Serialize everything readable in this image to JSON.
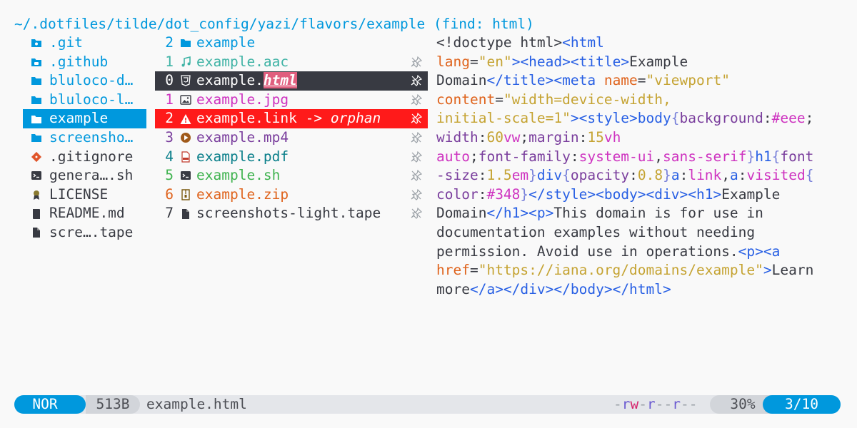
{
  "header": {
    "path": "~/.dotfiles/tilde/dot_config/yazi/flavors/example (find: html)"
  },
  "colors": {
    "accent": "#0098dd",
    "warning": "#ff1a1a",
    "selected": "#383a42",
    "highlight": "#e05e7e"
  },
  "parent": {
    "items": [
      {
        "name": ".git",
        "icon": "git-folder-icon",
        "color": "#0098dd"
      },
      {
        "name": ".github",
        "icon": "github-folder-icon",
        "color": "#0098dd"
      },
      {
        "name": "bluloco-d…",
        "icon": "folder-icon",
        "color": "#0098dd"
      },
      {
        "name": "bluloco-l…",
        "icon": "folder-icon",
        "color": "#0098dd"
      },
      {
        "name": "example",
        "icon": "folder-icon",
        "color": "#ffffff",
        "selected": true
      },
      {
        "name": "screensho…",
        "icon": "folder-icon",
        "color": "#0098dd"
      },
      {
        "name": ".gitignore",
        "icon": "git-icon",
        "color": "#383a42"
      },
      {
        "name": "genera….sh",
        "icon": "terminal-icon",
        "color": "#383a42"
      },
      {
        "name": "LICENSE",
        "icon": "license-icon",
        "color": "#383a42"
      },
      {
        "name": "README.md",
        "icon": "book-icon",
        "color": "#383a42"
      },
      {
        "name": "scre….tape",
        "icon": "file-icon",
        "color": "#383a42"
      }
    ]
  },
  "current": {
    "items": [
      {
        "num": "2",
        "name": "example",
        "icon": "folder-icon",
        "color": "#0098dd",
        "numcolor": "#0098dd"
      },
      {
        "num": "1",
        "name": "example.aac",
        "icon": "music-icon",
        "color": "#3fb3a5",
        "numcolor": "#3fb3a5",
        "pinned": true
      },
      {
        "num": "0",
        "name": "example.",
        "match": "html",
        "icon": "html5-icon",
        "color": "#ffffff",
        "numcolor": "#ffffff",
        "pinned": true,
        "selected": true
      },
      {
        "num": "1",
        "name": "example.jpg",
        "icon": "image-icon",
        "color": "#ce33c0",
        "numcolor": "#ce33c0",
        "pinned": true
      },
      {
        "num": "2",
        "name": "example.link -> ",
        "suffix": "orphan",
        "icon": "warning-icon",
        "color": "#ffffff",
        "numcolor": "#ffffff",
        "pinned": true,
        "warn": true
      },
      {
        "num": "3",
        "name": "example.mp4",
        "icon": "play-icon",
        "color": "#7a3e9d",
        "numcolor": "#7a3e9d",
        "pinned": true
      },
      {
        "num": "4",
        "name": "example.pdf",
        "icon": "pdf-icon",
        "color": "#0a7f8a",
        "numcolor": "#0a7f8a",
        "pinned": true
      },
      {
        "num": "5",
        "name": "example.sh",
        "icon": "terminal-icon",
        "color": "#3fb34f",
        "numcolor": "#3fb34f",
        "pinned": true
      },
      {
        "num": "6",
        "name": "example.zip",
        "icon": "zip-icon",
        "color": "#df631c",
        "numcolor": "#df631c",
        "pinned": true
      },
      {
        "num": "7",
        "name": "screenshots-light.tape",
        "icon": "file-icon",
        "color": "#383a42",
        "numcolor": "#383a42",
        "pinned": true
      }
    ]
  },
  "preview": {
    "lines": [
      [
        [
          "t-text",
          "<!doctype html>"
        ],
        [
          "t-tag",
          "<html"
        ]
      ],
      [
        [
          "t-attr",
          "lang"
        ],
        [
          "t-text",
          "="
        ],
        [
          "t-str",
          "\"en\""
        ],
        [
          "t-tag",
          ">"
        ],
        [
          "t-tag",
          "<head>"
        ],
        [
          "t-tag",
          "<title>"
        ],
        [
          "t-text",
          "Example"
        ]
      ],
      [
        [
          "t-text",
          "Domain"
        ],
        [
          "t-tag",
          "</title>"
        ],
        [
          "t-tag",
          "<meta "
        ],
        [
          "t-attr",
          "name"
        ],
        [
          "t-text",
          "="
        ],
        [
          "t-str",
          "\"viewport\""
        ]
      ],
      [
        [
          "t-attr",
          "content"
        ],
        [
          "t-text",
          "="
        ],
        [
          "t-str",
          "\"width=device-width,"
        ]
      ],
      [
        [
          "t-str",
          "initial-scale=1\""
        ],
        [
          "t-tag",
          ">"
        ],
        [
          "t-tag",
          "<style>"
        ],
        [
          "t-tag",
          "body"
        ],
        [
          "t-punct",
          "{"
        ],
        [
          "t-prop",
          "background"
        ],
        [
          "t-text",
          ":"
        ],
        [
          "t-val",
          "#eee"
        ],
        [
          "t-text",
          ";"
        ]
      ],
      [
        [
          "t-prop",
          "width"
        ],
        [
          "t-text",
          ":"
        ],
        [
          "t-num",
          "60"
        ],
        [
          "t-val",
          "vw"
        ],
        [
          "t-text",
          ";"
        ],
        [
          "t-prop",
          "margin"
        ],
        [
          "t-text",
          ":"
        ],
        [
          "t-num",
          "15"
        ],
        [
          "t-val",
          "vh"
        ]
      ],
      [
        [
          "t-val",
          "auto"
        ],
        [
          "t-text",
          ";"
        ],
        [
          "t-prop",
          "font-family"
        ],
        [
          "t-text",
          ":"
        ],
        [
          "t-val",
          "system-ui"
        ],
        [
          "t-text",
          ","
        ],
        [
          "t-val",
          "sans-serif"
        ],
        [
          "t-punct",
          "}"
        ],
        [
          "t-tag",
          "h1"
        ],
        [
          "t-punct",
          "{"
        ],
        [
          "t-prop",
          "font"
        ]
      ],
      [
        [
          "t-prop",
          "-size"
        ],
        [
          "t-text",
          ":"
        ],
        [
          "t-num",
          "1.5"
        ],
        [
          "t-val",
          "em"
        ],
        [
          "t-punct",
          "}"
        ],
        [
          "t-tag",
          "div"
        ],
        [
          "t-punct",
          "{"
        ],
        [
          "t-prop",
          "opacity"
        ],
        [
          "t-text",
          ":"
        ],
        [
          "t-num",
          "0.8"
        ],
        [
          "t-punct",
          "}"
        ],
        [
          "t-tag",
          "a"
        ],
        [
          "t-text",
          ":"
        ],
        [
          "t-val",
          "link"
        ],
        [
          "t-text",
          ","
        ],
        [
          "t-tag",
          "a"
        ],
        [
          "t-text",
          ":"
        ],
        [
          "t-val",
          "visited"
        ],
        [
          "t-punct",
          "{"
        ]
      ],
      [
        [
          "t-prop",
          "color"
        ],
        [
          "t-text",
          ":"
        ],
        [
          "t-val",
          "#348"
        ],
        [
          "t-punct",
          "}"
        ],
        [
          "t-tag",
          "</style>"
        ],
        [
          "t-tag",
          "<body>"
        ],
        [
          "t-tag",
          "<div>"
        ],
        [
          "t-tag",
          "<h1>"
        ],
        [
          "t-text",
          "Example"
        ]
      ],
      [
        [
          "t-text",
          "Domain"
        ],
        [
          "t-tag",
          "</h1>"
        ],
        [
          "t-tag",
          "<p>"
        ],
        [
          "t-text",
          "This domain is for use in"
        ]
      ],
      [
        [
          "t-text",
          "documentation examples without needing"
        ]
      ],
      [
        [
          "t-text",
          "permission. Avoid use in operations."
        ],
        [
          "t-tag",
          "<p>"
        ],
        [
          "t-tag",
          "<a"
        ]
      ],
      [
        [
          "t-attr",
          "href"
        ],
        [
          "t-text",
          "="
        ],
        [
          "t-str",
          "\"https://iana.org/domains/example\""
        ],
        [
          "t-tag",
          ">"
        ],
        [
          "t-text",
          "Learn"
        ]
      ],
      [
        [
          "t-text",
          "more"
        ],
        [
          "t-tag",
          "</a>"
        ],
        [
          "t-tag",
          "</div>"
        ],
        [
          "t-tag",
          "</body>"
        ],
        [
          "t-tag",
          "</html>"
        ]
      ]
    ]
  },
  "status": {
    "mode": "NOR",
    "size": "513B",
    "filename": "example.html",
    "permissions": "-rw-r--r--",
    "percent": "30%",
    "position": "3/10"
  }
}
